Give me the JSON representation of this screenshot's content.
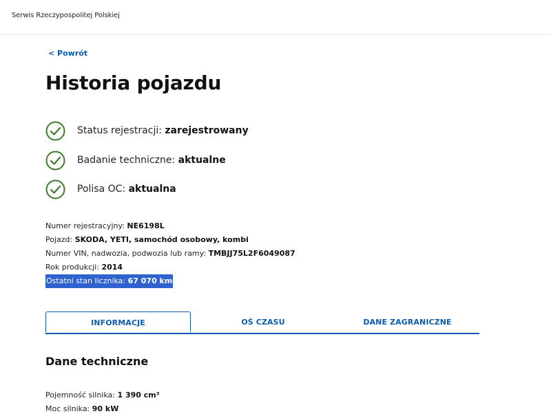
{
  "header": {
    "site_name": "Serwis Rzeczypospolitej Polskiej"
  },
  "nav": {
    "back_label": "< Powrót"
  },
  "page": {
    "title": "Historia pojazdu"
  },
  "statuses": [
    {
      "label": "Status rejestracji: ",
      "value": "zarejestrowany",
      "icon": "check-circle-icon"
    },
    {
      "label": "Badanie techniczne: ",
      "value": "aktualne",
      "icon": "check-circle-icon"
    },
    {
      "label": "Polisa OC: ",
      "value": "aktualna",
      "icon": "check-circle-icon"
    }
  ],
  "vehicle": [
    {
      "label": "Numer rejestracyjny: ",
      "value": "NE6198L"
    },
    {
      "label": "Pojazd: ",
      "value": "SKODA, YETI, samochód osobowy, kombi"
    },
    {
      "label": "Numer VIN, nadwozia, podwozia lub ramy: ",
      "value": "TMBJJ75L2F6049087"
    },
    {
      "label": "Rok produkcji: ",
      "value": "2014"
    },
    {
      "label": "Ostatni stan licznika: ",
      "value": "67 070 km"
    }
  ],
  "tabs": [
    {
      "label": "INFORMACJE",
      "active": true
    },
    {
      "label": "OŚ CZASU",
      "active": false
    },
    {
      "label": "DANE ZAGRANICZNE",
      "active": false
    }
  ],
  "technical": {
    "title": "Dane techniczne",
    "items": [
      {
        "label": "Pojemność silnika: ",
        "value": "1 390 cm³"
      },
      {
        "label": "Moc silnika: ",
        "value": "90 kW"
      }
    ]
  },
  "colors": {
    "accent": "#0b5cad",
    "check": "#3d7a2d",
    "selection": "#2f62cf"
  }
}
